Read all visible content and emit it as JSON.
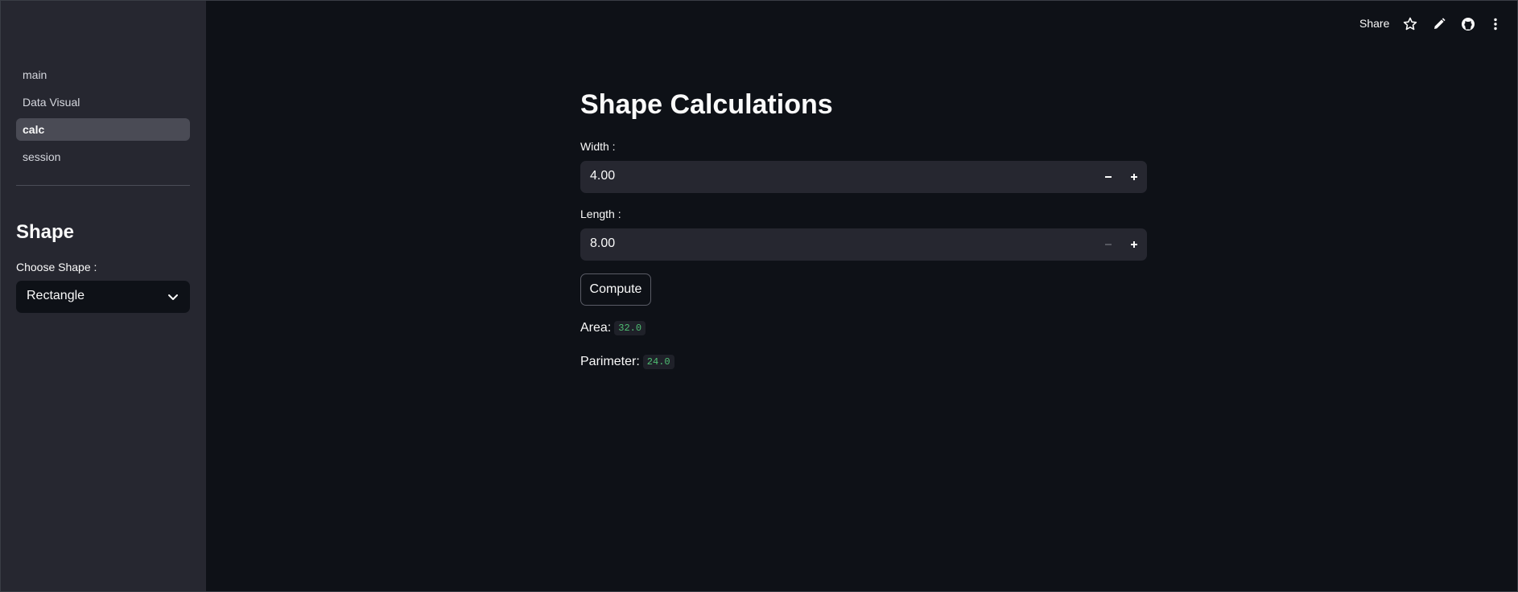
{
  "sidebar": {
    "nav": [
      {
        "label": "main"
      },
      {
        "label": "Data Visual"
      },
      {
        "label": "calc",
        "active": true
      },
      {
        "label": "session"
      }
    ],
    "header": "Shape",
    "shape_select": {
      "label": "Choose Shape :",
      "value": "Rectangle"
    }
  },
  "toolbar": {
    "share": "Share",
    "icons": [
      "star-icon",
      "pencil-icon",
      "github-icon",
      "more-vertical-icon"
    ]
  },
  "main": {
    "title": "Shape Calculations",
    "width": {
      "label": "Width :",
      "value": "4.00"
    },
    "length": {
      "label": "Length :",
      "value": "8.00"
    },
    "compute": "Compute",
    "area": {
      "label": "Area:",
      "value": "32.0"
    },
    "perimeter": {
      "label": "Parimeter:",
      "value": "24.0"
    }
  },
  "colors": {
    "background": "#0e1117",
    "sidebar": "#262730",
    "input": "#262730",
    "code_text": "#4fbf73"
  }
}
